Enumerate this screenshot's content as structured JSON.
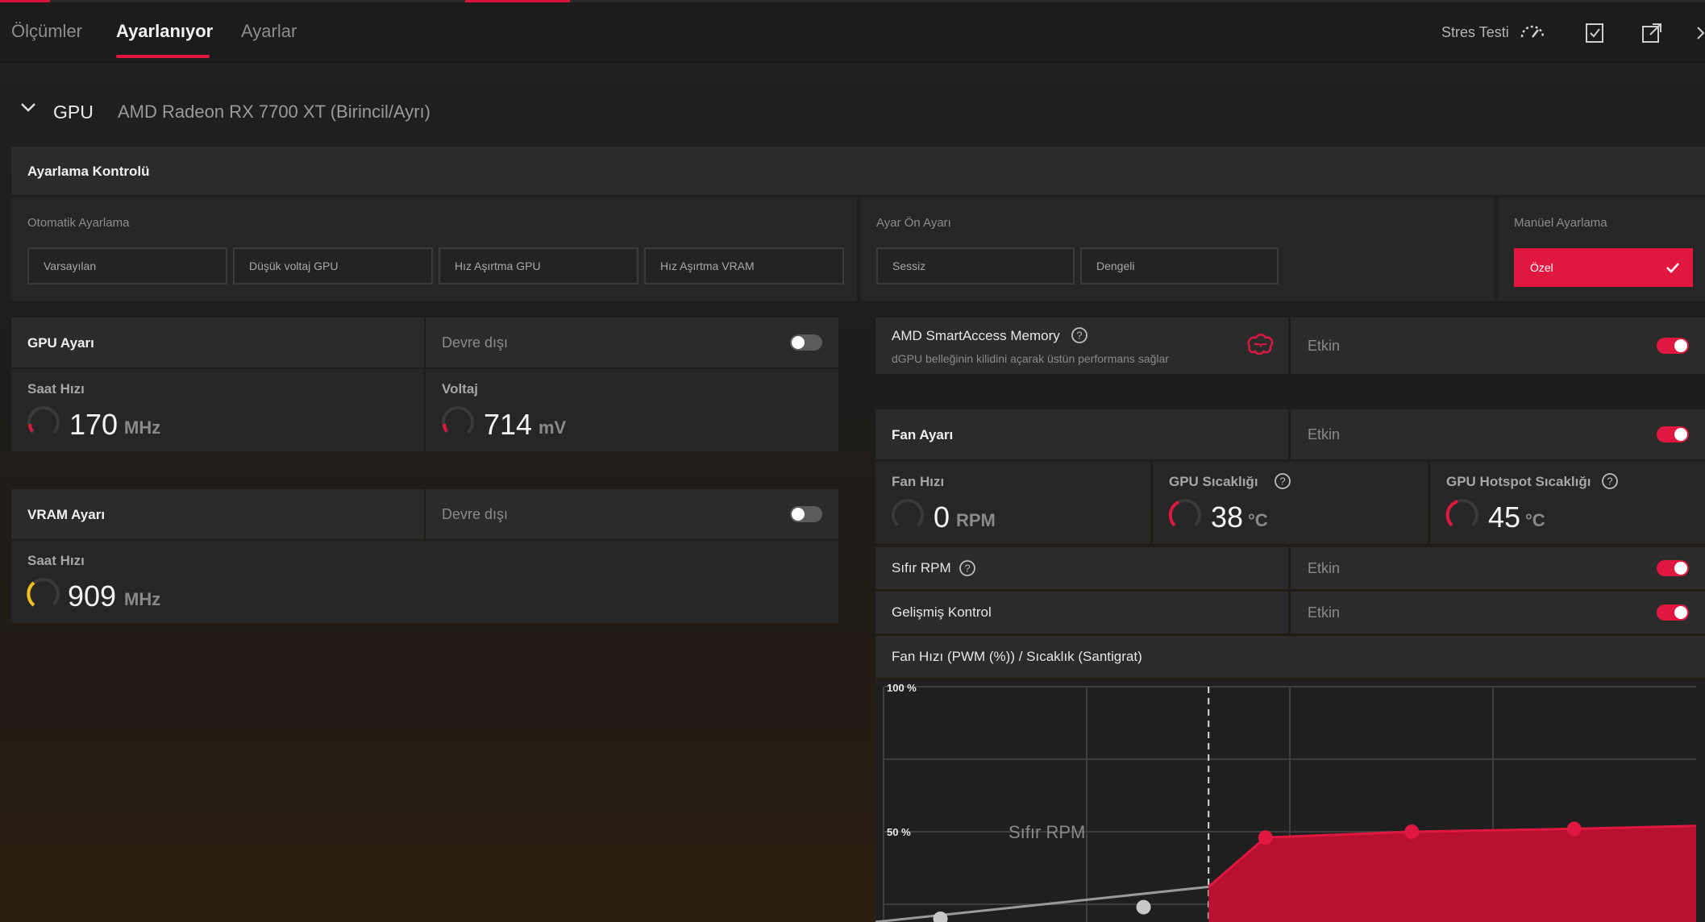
{
  "tabs": [
    {
      "label": "Ölçümler"
    },
    {
      "label": "Ayarlanıyor"
    },
    {
      "label": "Ayarlar"
    }
  ],
  "toolbar": {
    "stress_test_label": "Stres Testi",
    "icons": [
      "gauge-icon",
      "checklist-icon",
      "export-icon",
      "more-icon"
    ]
  },
  "gpu": {
    "label": "GPU",
    "name": "AMD Radeon RX 7700 XT (Birincil/Ayrı)"
  },
  "tuning_control": {
    "title": "Ayarlama Kontrolü",
    "auto": {
      "label": "Otomatik Ayarlama",
      "buttons": [
        "Varsayılan",
        "Düşük voltaj GPU",
        "Hız Aşırtma GPU",
        "Hız Aşırtma VRAM"
      ]
    },
    "preset": {
      "label": "Ayar Ön Ayarı",
      "buttons": [
        "Sessiz",
        "Dengeli"
      ]
    },
    "manual": {
      "label": "Manüel Ayarlama",
      "selected": "Özel"
    }
  },
  "gpu_tuning": {
    "title": "GPU Ayarı",
    "state": "Devre dışı",
    "enabled": false,
    "clock": {
      "label": "Saat Hızı",
      "value": "170",
      "unit": "MHz"
    },
    "voltage": {
      "label": "Voltaj",
      "value": "714",
      "unit": "mV"
    }
  },
  "vram_tuning": {
    "title": "VRAM Ayarı",
    "state": "Devre dışı",
    "enabled": false,
    "clock": {
      "label": "Saat Hızı",
      "value": "909",
      "unit": "MHz"
    }
  },
  "sam": {
    "title": "AMD SmartAccess Memory",
    "subtitle": "dGPU belleğinin kilidini açarak üstün performans sağlar",
    "state": "Etkin",
    "enabled": true
  },
  "fan_tuning": {
    "title": "Fan Ayarı",
    "state": "Etkin",
    "enabled": true,
    "fan_speed": {
      "label": "Fan Hızı",
      "value": "0",
      "unit": "RPM"
    },
    "gpu_temp": {
      "label": "GPU Sıcaklığı",
      "value": "38",
      "unit": "°C"
    },
    "hotspot_temp": {
      "label": "GPU Hotspot Sıcaklığı",
      "value": "45",
      "unit": "°C"
    },
    "zero_rpm": {
      "label": "Sıfır RPM",
      "state": "Etkin",
      "enabled": true
    },
    "advanced": {
      "label": "Gelişmiş Kontrol",
      "state": "Etkin",
      "enabled": true
    }
  },
  "colors": {
    "accent": "#e0183f",
    "gauge_yellow": "#f0c020"
  },
  "chart_data": {
    "type": "area",
    "title": "Fan Hızı (PWM (%)) / Sıcaklık (Santigrat)",
    "y_tick_labels": [
      "100 %",
      "50 %"
    ],
    "ylim": [
      0,
      100
    ],
    "annotation": "Sıfır RPM",
    "zero_rpm_region_points": [
      [
        0,
        0
      ],
      [
        40,
        17
      ]
    ],
    "curve_points": [
      [
        47,
        48
      ],
      [
        65,
        50
      ],
      [
        85,
        51
      ]
    ],
    "grid": true
  }
}
